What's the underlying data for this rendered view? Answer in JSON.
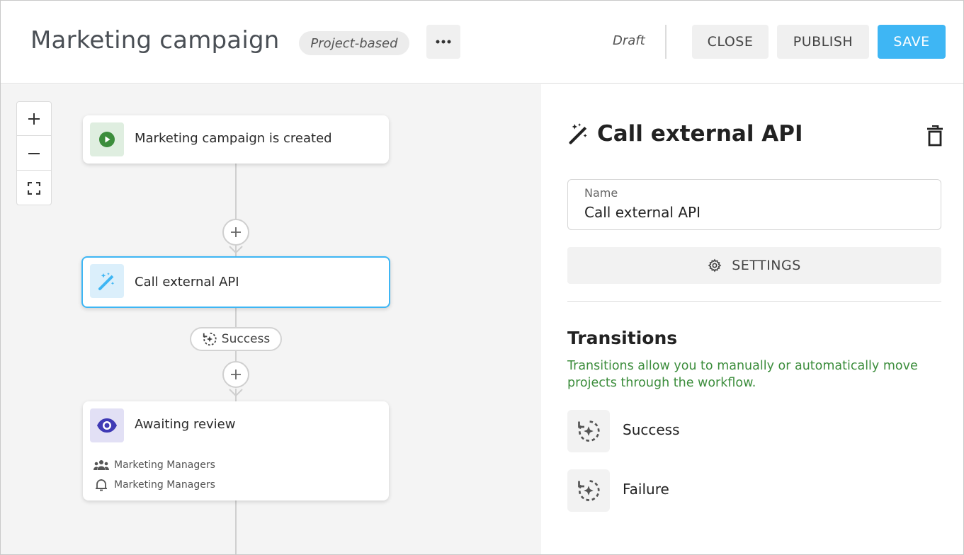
{
  "header": {
    "title": "Marketing campaign",
    "type_badge": "Project-based",
    "status": "Draft",
    "close_label": "CLOSE",
    "publish_label": "PUBLISH",
    "save_label": "SAVE"
  },
  "canvas": {
    "zoom_in_icon": "plus-icon",
    "zoom_out_icon": "minus-icon",
    "fit_icon": "fit-screen-icon",
    "nodes": [
      {
        "label": "Marketing campaign is created",
        "icon": "play-icon",
        "icon_bg": "#dfeee0",
        "icon_color": "#3c8d3c"
      },
      {
        "label": "Call external API",
        "icon": "magic-wand-icon",
        "icon_bg": "#dbeffb",
        "icon_color": "#3eb6f4",
        "selected": true
      },
      {
        "label": "Awaiting review",
        "icon": "eye-icon",
        "icon_bg": "#e2e0f5",
        "icon_color": "#3f3ab5",
        "assignees": "Marketing Managers",
        "notifications": "Marketing Managers"
      }
    ],
    "transition_pill": "Success"
  },
  "panel": {
    "title": "Call external API",
    "name_label": "Name",
    "name_value": "Call external API",
    "settings_label": "SETTINGS",
    "transitions_title": "Transitions",
    "transitions_desc": "Transitions allow you to manually or automatically move projects through the workflow.",
    "transitions": [
      {
        "label": "Success",
        "icon": "auto-transition-icon"
      },
      {
        "label": "Failure",
        "icon": "auto-transition-icon"
      }
    ]
  },
  "colors": {
    "accent": "#3eb6f4",
    "success_text": "#3c8d3c",
    "canvas_bg": "#f4f4f4"
  }
}
